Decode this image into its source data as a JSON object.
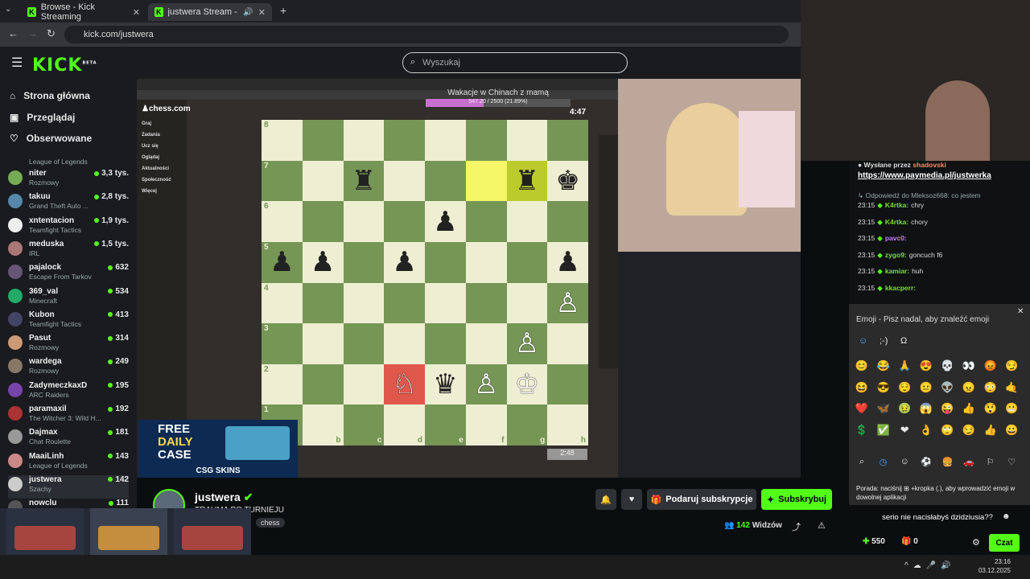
{
  "browser": {
    "tabs": [
      {
        "label": "Browse - Kick Streaming"
      },
      {
        "label": "justwera Stream - Watch Li"
      }
    ],
    "url": "kick.com/justwera"
  },
  "header": {
    "logo": "KICK",
    "logo_sup": "BETA",
    "search_placeholder": "Wyszukaj"
  },
  "sidebar": {
    "nav": [
      {
        "label": "Strona główna"
      },
      {
        "label": "Przeglądaj"
      },
      {
        "label": "Obserwowane"
      }
    ],
    "top_game": "League of Legends",
    "channels": [
      {
        "name": "niter",
        "game": "Rozmowy",
        "viewers": "3,3 tys.",
        "color": "#7a5"
      },
      {
        "name": "takuu",
        "game": "Grand Theft Auto ...",
        "viewers": "2,8 tys.",
        "color": "#58a"
      },
      {
        "name": "xntentacion",
        "game": "Teamfight Tactics",
        "viewers": "1,9 tys.",
        "color": "#eee"
      },
      {
        "name": "meduska",
        "game": "IRL",
        "viewers": "1,5 tys.",
        "color": "#a77"
      },
      {
        "name": "pajalock",
        "game": "Escape From Tarkov",
        "viewers": "632",
        "color": "#657"
      },
      {
        "name": "369_val",
        "game": "Minecraft",
        "viewers": "534",
        "color": "#2a6"
      },
      {
        "name": "Kubon",
        "game": "Teamfight Tactics",
        "viewers": "413",
        "color": "#446"
      },
      {
        "name": "Pasut",
        "game": "Rozmowy",
        "viewers": "314",
        "color": "#c97"
      },
      {
        "name": "wardega",
        "game": "Rozmowy",
        "viewers": "249",
        "color": "#876"
      },
      {
        "name": "ZadymeczkaxD",
        "game": "ARC Raiders",
        "viewers": "195",
        "color": "#74a"
      },
      {
        "name": "paramaxil",
        "game": "The Witcher 3: Wild H...",
        "viewers": "192",
        "color": "#a33"
      },
      {
        "name": "Dajmax",
        "game": "Chat Roulette",
        "viewers": "181",
        "color": "#999"
      },
      {
        "name": "MaaiLinh",
        "game": "League of Legends",
        "viewers": "143",
        "color": "#c88"
      },
      {
        "name": "justwera",
        "game": "Szachy",
        "viewers": "142",
        "color": "#ccc"
      },
      {
        "name": "nowclu",
        "game": "",
        "viewers": "111",
        "color": "#555"
      }
    ]
  },
  "stream": {
    "chess_title": "Wakacje w Chinach z mamą",
    "progress_text": "547.20 / 2500 (21.89%)",
    "clock_top": "4:47",
    "clock_bottom": "2:48",
    "chess_menu": [
      "Graj",
      "Zadania",
      "Ucz się",
      "Oglądaj",
      "Aktualności",
      "Społeczność",
      "Więcej"
    ],
    "files": [
      "a",
      "b",
      "c",
      "d",
      "e",
      "f",
      "g",
      "h"
    ],
    "board": [
      [
        "",
        "",
        "",
        "",
        "",
        "",
        "",
        ""
      ],
      [
        "",
        "",
        "♜",
        "",
        "",
        "",
        "♜",
        "♚"
      ],
      [
        "",
        "",
        "",
        "",
        "♟",
        "",
        "",
        ""
      ],
      [
        "♟",
        "♟",
        "",
        "♟",
        "",
        "",
        "",
        "♟"
      ],
      [
        "",
        "",
        "",
        "",
        "",
        "",
        "",
        "♙"
      ],
      [
        "",
        "",
        "",
        "",
        "",
        "",
        "♙",
        ""
      ],
      [
        "",
        "",
        "",
        "♘",
        "♛",
        "♙",
        "♔",
        ""
      ],
      [
        "",
        "",
        "",
        "",
        "",
        "",
        "",
        ""
      ]
    ],
    "promo": {
      "l1": "FREE",
      "l2": "DAILY",
      "l3": "CASE",
      "brand": "CSG SKINS"
    }
  },
  "info": {
    "streamer": "justwera",
    "title": "TRAUMA PO TURNIEJU",
    "tag": "chess",
    "subscribe_gift": "Podaruj subskrypcje",
    "subscribe": "Subskrybuj",
    "viewers": "142",
    "viewers_label": "Widzów"
  },
  "chat": {
    "sent_by": "Wysłane przez",
    "sent_user": "shadovski",
    "link": "https://www.paymedia.pl/justwerka",
    "reply": "Odpowiedź do Mleksoz668: co jestem",
    "lines": [
      {
        "time": "23:15",
        "user": "K4rtka:",
        "msg": "chry",
        "ucolor": "#7ddc38"
      },
      {
        "time": "23:15",
        "user": "K4rtka:",
        "msg": "chory",
        "ucolor": "#7ddc38"
      },
      {
        "time": "23:15",
        "user": "pavc0:",
        "msg": "",
        "ucolor": "#c67cff"
      },
      {
        "time": "23:15",
        "user": "zygo9:",
        "msg": "goncuch f6",
        "ucolor": "#7ddc38"
      },
      {
        "time": "23:15",
        "user": "kamiar:",
        "msg": "huh",
        "ucolor": "#7ddc38"
      },
      {
        "time": "23:15",
        "user": "kkacperr:",
        "msg": "",
        "ucolor": "#7ddc38"
      }
    ],
    "emoji_title": "Emoji - Pisz nadal, aby znaleźć emoji",
    "hint": "Porada: naciśnij ⊞ +kropka (.), aby wprowadzić emoji w dowolnej aplikacji",
    "input_text": "serio nie nacisłabyś dzidziusia??",
    "points": "550",
    "gifts": "0",
    "send": "Czat"
  },
  "skins": [
    "Neoqueen",
    "Lore",
    "Asiimov"
  ],
  "taskbar": {
    "time": "23:16",
    "date": "03.12.2025"
  },
  "colors": {
    "accent": "#53fc18"
  }
}
